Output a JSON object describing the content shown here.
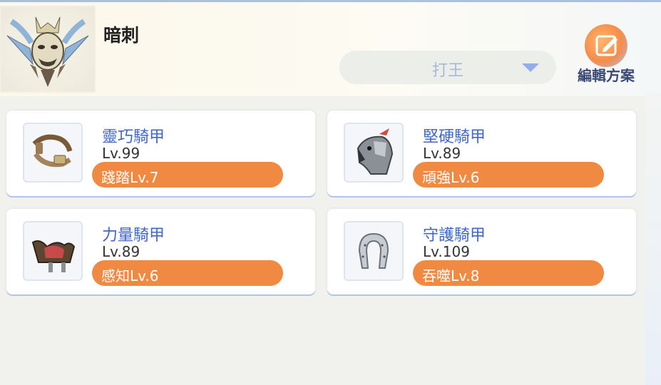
{
  "class_name": "暗刺",
  "preset": {
    "selected": "打王"
  },
  "edit_button": {
    "label": "編輯方案"
  },
  "cards": [
    {
      "name": "靈巧騎甲",
      "level": "Lv.99",
      "skill": "踐踏Lv.7",
      "icon": "saddle-harness-icon"
    },
    {
      "name": "堅硬騎甲",
      "level": "Lv.89",
      "skill": "頑強Lv.6",
      "icon": "armored-horse-head-icon"
    },
    {
      "name": "力量騎甲",
      "level": "Lv.89",
      "skill": "感知Lv.6",
      "icon": "saddle-icon"
    },
    {
      "name": "守護騎甲",
      "level": "Lv.109",
      "skill": "吞噬Lv.8",
      "icon": "horseshoe-icon"
    }
  ],
  "colors": {
    "accent_orange": "#f08a43",
    "title_blue": "#3f67c8",
    "edit_label": "#3b4a74"
  }
}
